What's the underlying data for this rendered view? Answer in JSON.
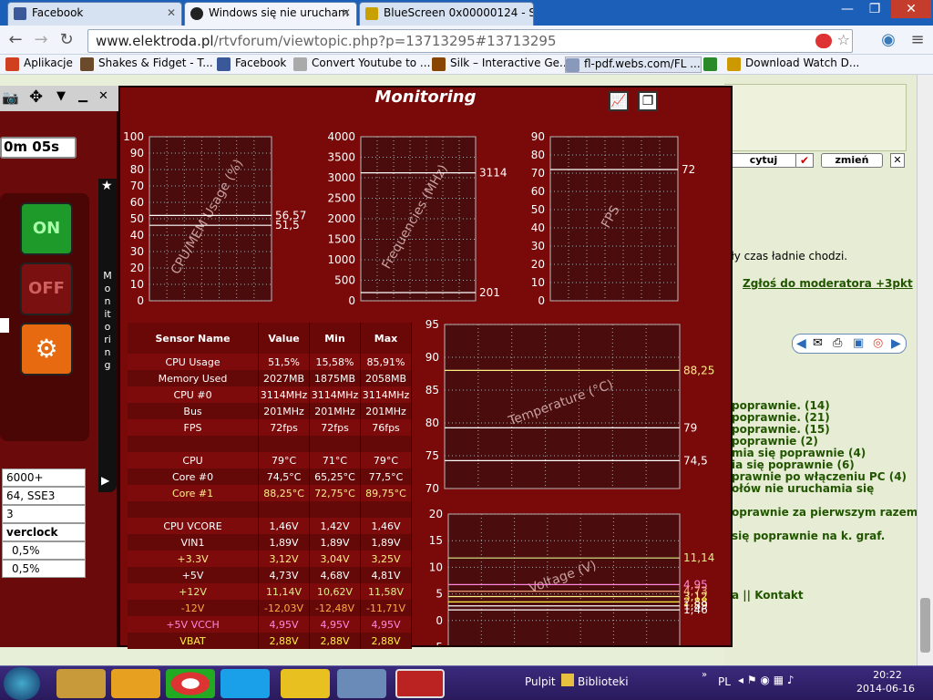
{
  "browser": {
    "tabs": [
      {
        "label": "Facebook",
        "color": "#3b5998"
      },
      {
        "label": "Windows się nie urucham",
        "color": "#222222"
      },
      {
        "label": "BlueScreen 0x00000124 - S",
        "color": "#c8a000"
      }
    ],
    "url_domain": "www.elektroda.pl",
    "url_path": "/rtvforum/viewtopic.php?p=13713295#13713295",
    "bookmarks": [
      {
        "label": "Aplikacje",
        "color": "#d04020"
      },
      {
        "label": "Shakes & Fidget - T...",
        "color": "#6a4a2a"
      },
      {
        "label": "Facebook",
        "color": "#3b5998"
      },
      {
        "label": "Convert Youtube to ...",
        "color": "#aaaaaa"
      },
      {
        "label": "Silk – Interactive Ge...",
        "color": "#884400"
      },
      {
        "label": "fl-pdf.webs.com/FL ...",
        "color": "#8899bb"
      },
      {
        "label": "",
        "color": "#2a8a2a"
      },
      {
        "label": "Download Watch D...",
        "color": "#cc9900"
      }
    ]
  },
  "forum": {
    "buttons": [
      "cytuj",
      "zmień"
    ],
    "text1": "ały czas ładnie chodzi.",
    "report_link": "Zgłoś do moderatora +3pkt",
    "links": [
      "poprawnie. (14)",
      "poprawnie. (21)",
      "poprawnie. (15)",
      "poprawnie (2)",
      "mia się poprawnie (4)",
      "ia się poprawnie (6)",
      "prawnie po włączeniu PC (4)",
      "ołów nie uruchamia się",
      "oprawnie za pierwszym razem.",
      "się poprawnie na k. graf."
    ],
    "footer": "a || Kontakt"
  },
  "left_panel": {
    "timer": "0m 05s",
    "on_label": "ON",
    "off_label": "OFF",
    "vertical_label": "Monitoring",
    "items": [
      "6000+",
      "64, SSE3",
      "3",
      "verclock",
      "0,5%",
      "0,5%"
    ]
  },
  "monitor": {
    "title": "Monitoring",
    "graphs": {
      "cpu": {
        "label": "CPU/MEM Usage (%)",
        "ticks": [
          "100",
          "90",
          "80",
          "70",
          "60",
          "50",
          "40",
          "30",
          "20",
          "10",
          "0"
        ],
        "readouts": [
          "56,57",
          "51,5"
        ]
      },
      "freq": {
        "label": "Frequencies (MHz)",
        "ticks": [
          "4000",
          "3500",
          "3000",
          "2500",
          "2000",
          "1500",
          "1000",
          "500",
          "0"
        ],
        "readouts": [
          "3114",
          "201"
        ]
      },
      "fps": {
        "label": "FPS",
        "ticks": [
          "90",
          "80",
          "70",
          "60",
          "50",
          "40",
          "30",
          "20",
          "10",
          "0"
        ],
        "readouts": [
          "72"
        ]
      },
      "temp": {
        "label": "Temperature (°C)",
        "ticks": [
          "95",
          "90",
          "85",
          "80",
          "75",
          "70"
        ],
        "readouts": [
          "88,25",
          "79",
          "74,5"
        ]
      },
      "volt": {
        "label": "Voltage (V)",
        "ticks": [
          "20",
          "15",
          "10",
          "5",
          "0",
          "-5"
        ],
        "readouts": [
          "11,14",
          "4,95",
          "4,73",
          "3,12",
          "2,88",
          "1,89",
          "1,46"
        ]
      }
    },
    "table": {
      "headers": [
        "Sensor Name",
        "Value",
        "Min",
        "Max"
      ],
      "rows": [
        [
          "CPU Usage",
          "51,5%",
          "15,58%",
          "85,91%",
          "#ffffff"
        ],
        [
          "Memory Used",
          "2027MB",
          "1875MB",
          "2058MB",
          "#ffffff"
        ],
        [
          "CPU #0",
          "3114MHz",
          "3114MHz",
          "3114MHz",
          "#ffffff"
        ],
        [
          "Bus",
          "201MHz",
          "201MHz",
          "201MHz",
          "#ffffff"
        ],
        [
          "FPS",
          "72fps",
          "72fps",
          "76fps",
          "#ffffff"
        ],
        [
          "",
          "",
          "",
          "",
          "#ffffff"
        ],
        [
          "CPU",
          "79°C",
          "71°C",
          "79°C",
          "#ffffff"
        ],
        [
          "Core #0",
          "74,5°C",
          "65,25°C",
          "77,5°C",
          "#ffffff"
        ],
        [
          "Core #1",
          "88,25°C",
          "72,75°C",
          "89,75°C",
          "#ffee88"
        ],
        [
          "",
          "",
          "",
          "",
          "#ffffff"
        ],
        [
          "CPU VCORE",
          "1,46V",
          "1,42V",
          "1,46V",
          "#ffffff"
        ],
        [
          "VIN1",
          "1,89V",
          "1,89V",
          "1,89V",
          "#ffffff"
        ],
        [
          "+3.3V",
          "3,12V",
          "3,04V",
          "3,25V",
          "#ffee88"
        ],
        [
          "+5V",
          "4,73V",
          "4,68V",
          "4,81V",
          "#ffffff"
        ],
        [
          "+12V",
          "11,14V",
          "10,62V",
          "11,58V",
          "#ddee88"
        ],
        [
          "-12V",
          "-12,03V",
          "-12,48V",
          "-11,71V",
          "#ffaa44"
        ],
        [
          "+5V VCCH",
          "4,95V",
          "4,95V",
          "4,95V",
          "#ff88dd"
        ],
        [
          "VBAT",
          "2,88V",
          "2,88V",
          "2,88V",
          "#ffee44"
        ]
      ]
    }
  },
  "taskbar": {
    "desktop_label": "Pulpit",
    "library_label": "Biblioteki",
    "lang": "PL",
    "time": "20:22",
    "date": "2014-06-16"
  }
}
